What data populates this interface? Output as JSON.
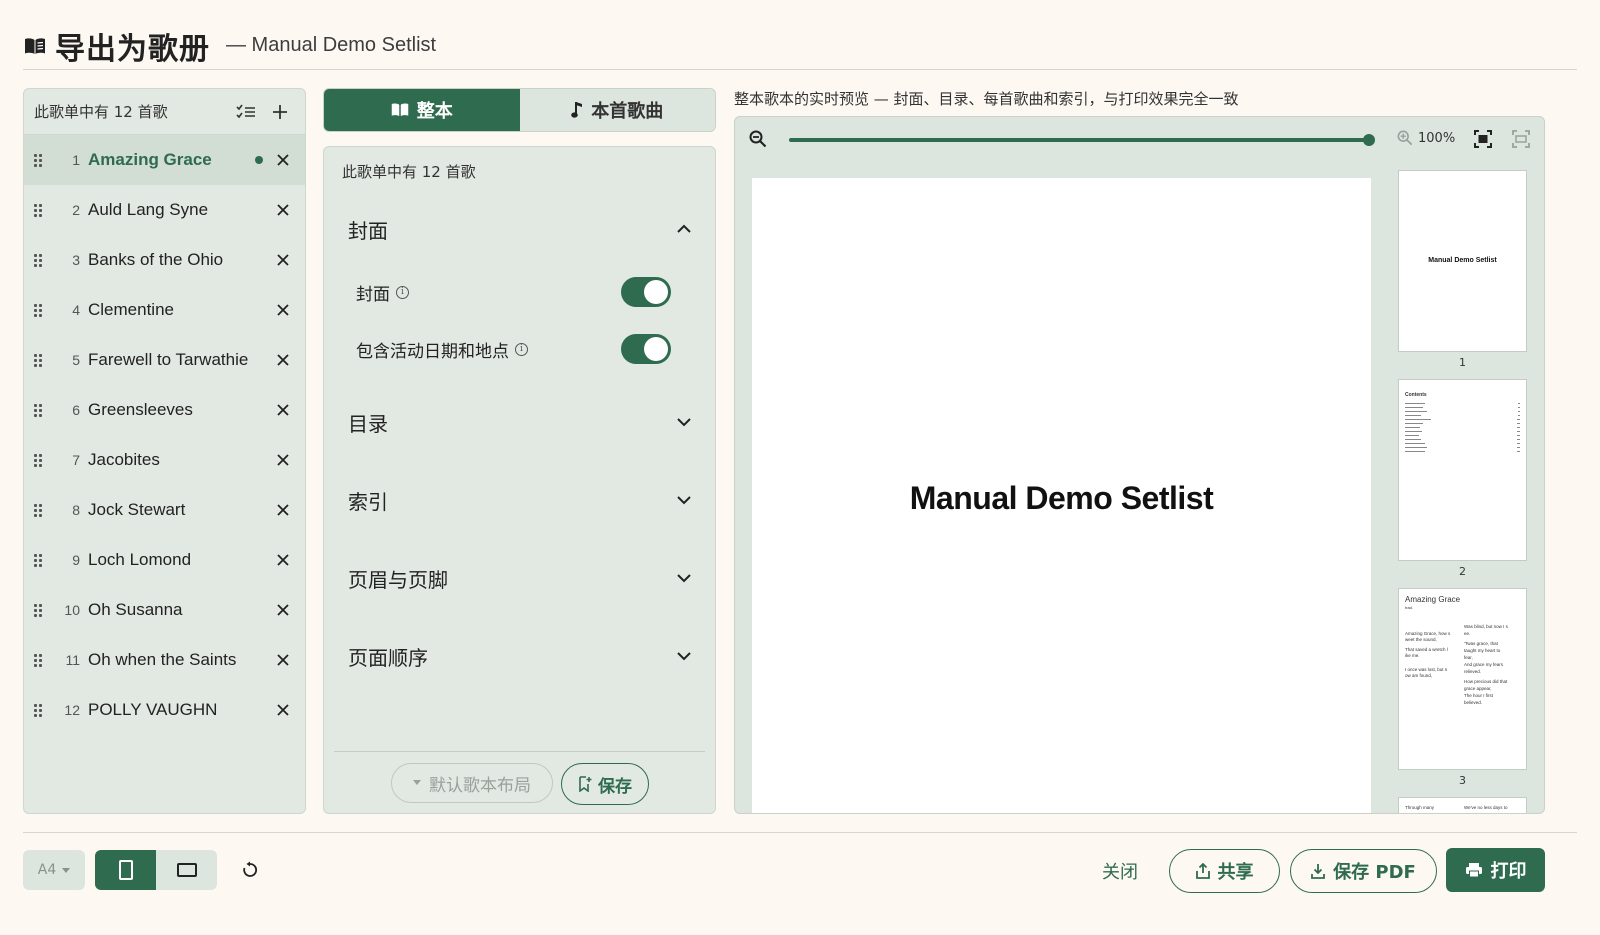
{
  "header": {
    "title": "导出为歌册",
    "subtitle": "— Manual Demo Setlist",
    "icon": "book-open-icon"
  },
  "song_panel": {
    "count_label": "此歌单中有 12 首歌",
    "songs": [
      {
        "num": "1",
        "title": "Amazing Grace"
      },
      {
        "num": "2",
        "title": "Auld Lang Syne"
      },
      {
        "num": "3",
        "title": "Banks of the Ohio"
      },
      {
        "num": "4",
        "title": "Clementine"
      },
      {
        "num": "5",
        "title": "Farewell to Tarwathie"
      },
      {
        "num": "6",
        "title": "Greensleeves"
      },
      {
        "num": "7",
        "title": "Jacobites"
      },
      {
        "num": "8",
        "title": "Jock Stewart"
      },
      {
        "num": "9",
        "title": "Loch Lomond"
      },
      {
        "num": "10",
        "title": "Oh Susanna"
      },
      {
        "num": "11",
        "title": "Oh when the Saints"
      },
      {
        "num": "12",
        "title": "POLLY VAUGHN"
      }
    ]
  },
  "tabs": {
    "whole": "整本",
    "single": "本首歌曲"
  },
  "settings": {
    "count_label": "此歌单中有 12 首歌",
    "cover_section": "封面",
    "cover_option": "封面",
    "date_option": "包含活动日期和地点",
    "toc_section": "目录",
    "index_section": "索引",
    "header_footer_section": "页眉与页脚",
    "page_order_section": "页面顺序",
    "layout_button": "默认歌本布局",
    "save_button": "保存"
  },
  "preview": {
    "caption": "整本歌本的实时预览 — 封面、目录、每首歌曲和索引，与打印效果完全一致",
    "zoom": "100%",
    "cover_title": "Manual Demo Setlist",
    "thumbs": {
      "p1_num": "1",
      "p1_title": "Manual Demo Setlist",
      "p2_num": "2",
      "p2_heading": "Contents",
      "p3_num": "3",
      "p3_title": "Amazing Grace",
      "p3_sub": "trad.",
      "p3_left": [
        "Amazing Grace, how s",
        "weet the sound,",
        "That saved a wretch l",
        "ike me.",
        "I once was lost, but n",
        "ow am found,"
      ],
      "p3_right": [
        "Was blind, but now I s",
        "ee.",
        "'Twas grace, that",
        "taught my heart to",
        "fear,",
        "And grace my fears",
        "relieved.",
        "How precious did that",
        "grace appear,",
        "The hour I first",
        "believed."
      ],
      "p4_left": "Through many",
      "p4_right": "We've no less days to"
    }
  },
  "footer": {
    "paper": "A4",
    "close": "关闭",
    "share": "共享",
    "save_pdf": "保存 PDF",
    "print": "打印"
  },
  "colors": {
    "accent": "#2e6b4f",
    "panel": "#e2e9e3",
    "background": "#fdf8f2"
  }
}
